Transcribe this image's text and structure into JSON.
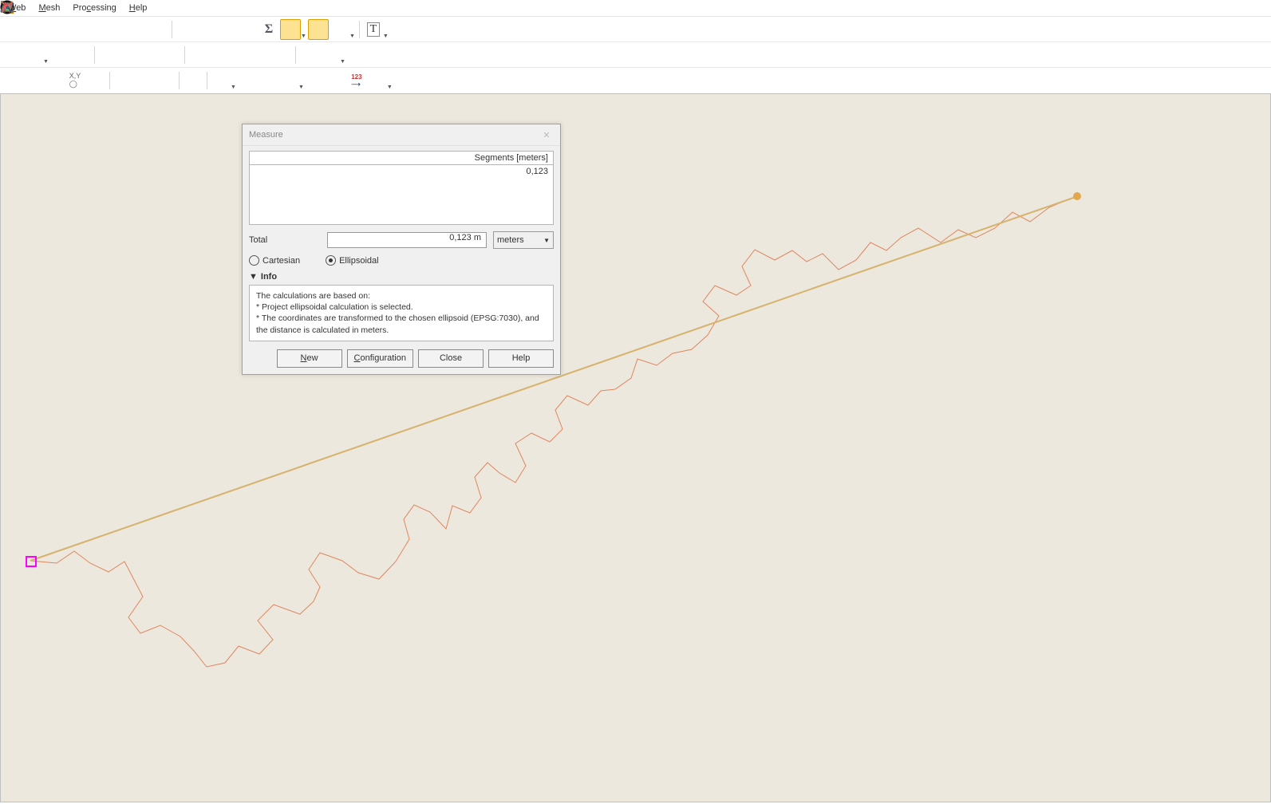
{
  "menu": {
    "web": "Web",
    "mesh": "Mesh",
    "processing": "Processing",
    "help": "Help"
  },
  "dialog": {
    "title": "Measure",
    "segments_header": "Segments [meters]",
    "segment_value": "0,123",
    "total_label": "Total",
    "total_value": "0,123 m",
    "unit": "meters",
    "cartesian": "Cartesian",
    "ellipsoidal": "Ellipsoidal",
    "info_label": "Info",
    "info_line1": "The calculations are based on:",
    "info_line2": "* Project ellipsoidal calculation is selected.",
    "info_line3": "* The coordinates are transformed to the chosen ellipsoid (EPSG:7030), and the distance is calculated in meters.",
    "btn_new": "New",
    "btn_config": "Configuration",
    "btn_close": "Close",
    "btn_help": "Help"
  },
  "icons": {
    "row1": [
      "zoom",
      "zoom-out",
      "open",
      "save",
      "export",
      "layout",
      "clock",
      "refresh",
      "",
      "identify",
      "table",
      "stats",
      "options",
      "sigma",
      "measure",
      "measure2",
      "zoom-reset",
      "",
      "text"
    ],
    "row2": [
      "edit",
      "polyline",
      "poly",
      "shape",
      "",
      "line",
      "line2",
      "square",
      "cut",
      "",
      "poly-edit",
      "cut2",
      "merge",
      "paste",
      "delete",
      "",
      "redo",
      "undo"
    ],
    "row3_group1": [
      "zoom-map",
      "zoom-sel",
      "world",
      "xy",
      "extent"
    ],
    "row3_group2": [
      "layer-in",
      "layer-out",
      "layer-tool"
    ],
    "row3_group3": [
      "share"
    ],
    "row3_group4": [
      "ring",
      "xy-num",
      "line-tool",
      "xline",
      "",
      "poly-tool",
      "ruler",
      "123",
      "sel"
    ],
    "row3_group5": [
      "auto",
      "node"
    ]
  }
}
